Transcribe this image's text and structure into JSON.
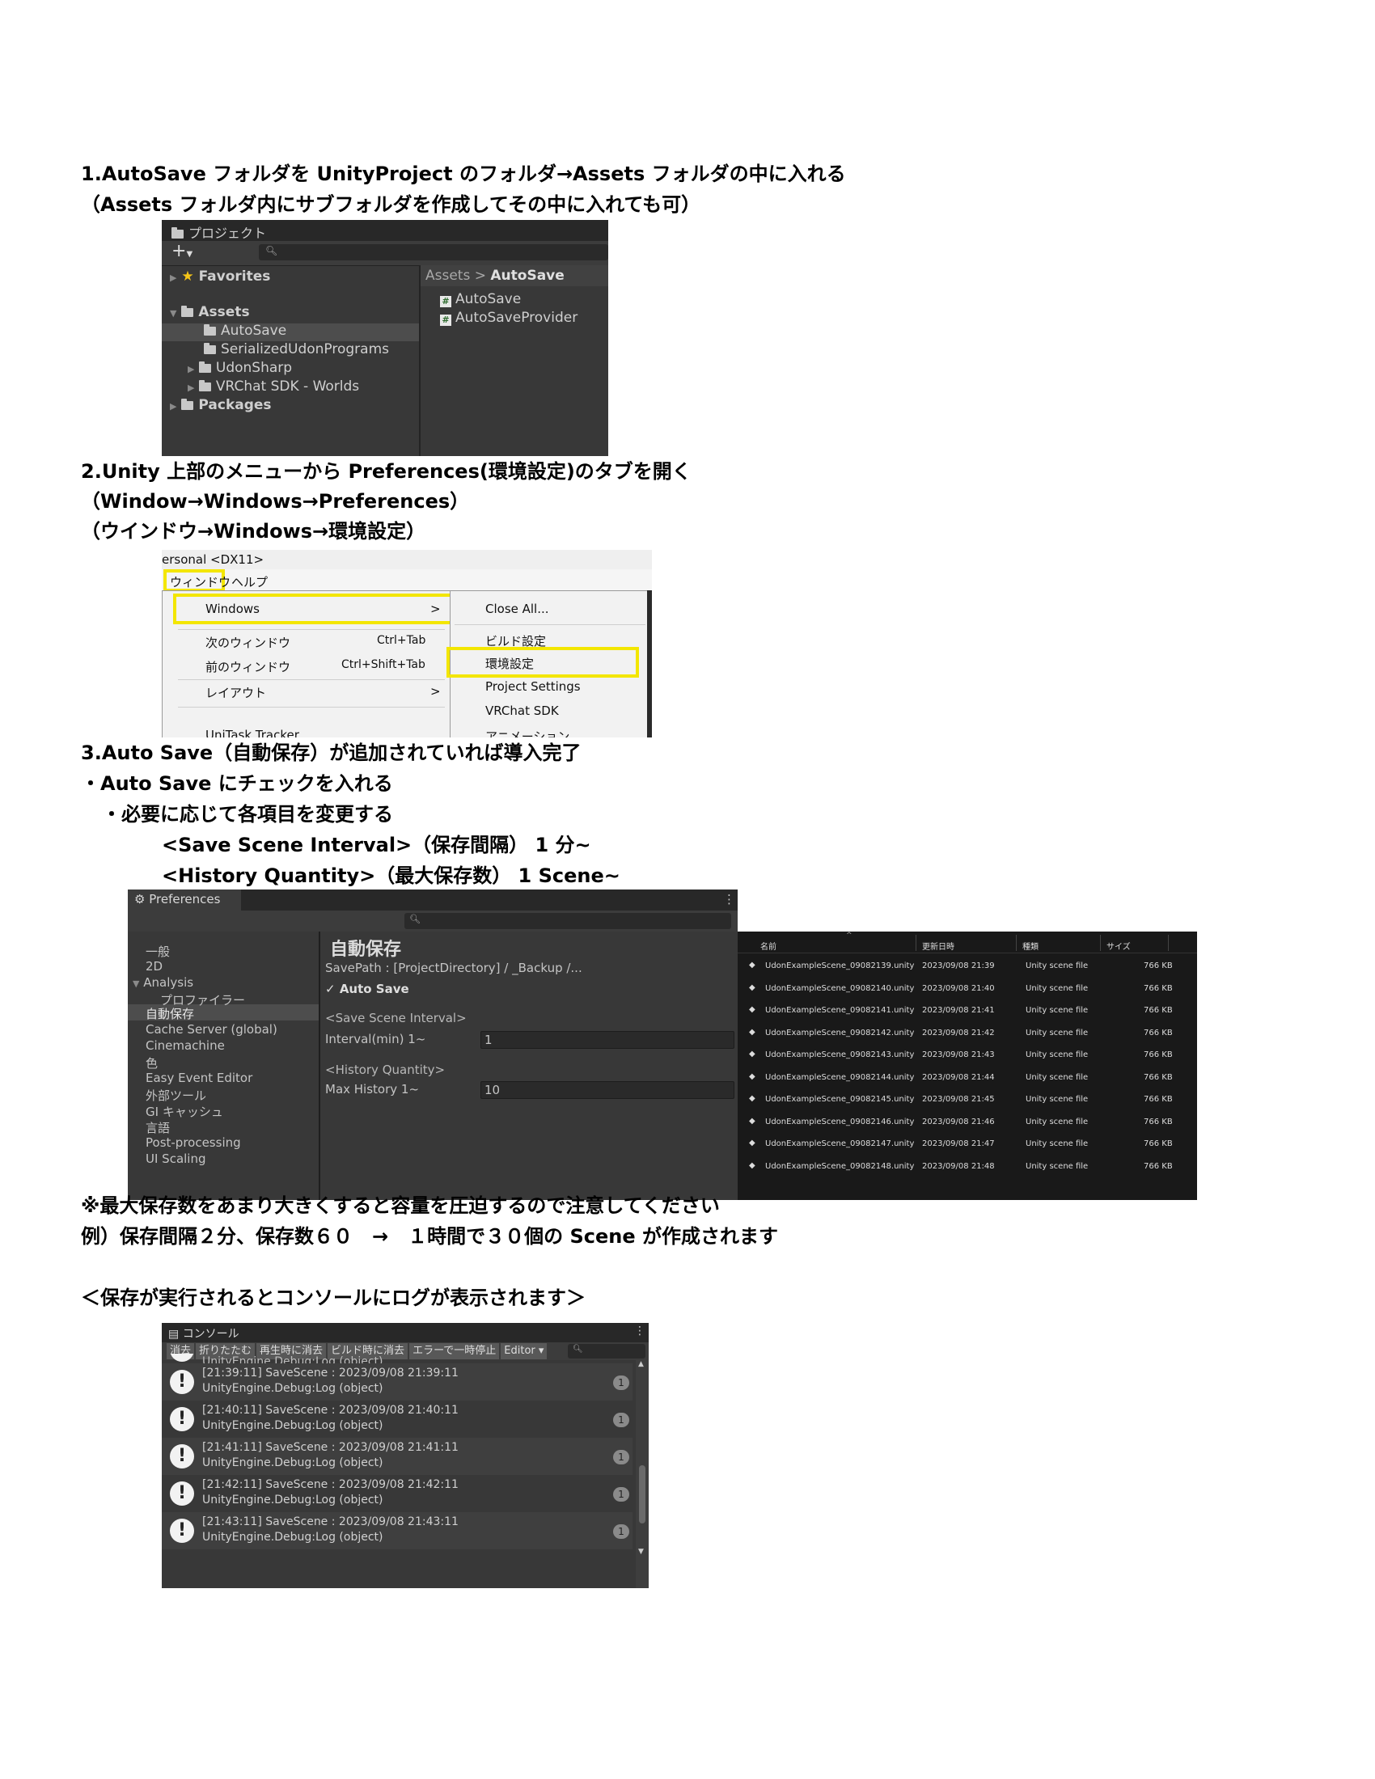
{
  "step1": {
    "line1": "1.AutoSave フォルダを UnityProject のフォルダ→Assets フォルダの中に入れる",
    "line2": "（Assets フォルダ内にサブフォルダを作成してその中に入れても可）"
  },
  "project_panel": {
    "tab_label": "プロジェクト",
    "add_label": "+",
    "favorites": "Favorites",
    "assets": "Assets",
    "folders": [
      "AutoSave",
      "SerializedUdonPrograms",
      "UdonSharp",
      "VRChat SDK - Worlds"
    ],
    "packages": "Packages",
    "breadcrumb_root": "Assets",
    "breadcrumb_sep": ">",
    "breadcrumb_current": "AutoSave",
    "files": [
      "AutoSave",
      "AutoSaveProvider"
    ]
  },
  "step2": {
    "line1": "2.Unity 上部のメニューから Preferences(環境設定)のタブを開く",
    "line2": "（Window→Windows→Preferences）",
    "line3": "（ウインドウ→Windows→環境設定）"
  },
  "menu": {
    "title_fragment": "ersonal <DX11>",
    "menubar": [
      "ウィンドウ",
      "ヘルプ"
    ],
    "left_items": [
      {
        "label": "Windows",
        "shortcut": ">"
      },
      {
        "label": "次のウィンドウ",
        "shortcut": "Ctrl+Tab"
      },
      {
        "label": "前のウィンドウ",
        "shortcut": "Ctrl+Shift+Tab"
      },
      {
        "label": "レイアウト",
        "shortcut": ">"
      },
      {
        "label": "UniTask Tracker",
        "shortcut": ""
      }
    ],
    "right_items": [
      "Close All...",
      "ビルド設定",
      "環境設定",
      "Project Settings",
      "VRChat SDK",
      "アニメーション"
    ]
  },
  "step3": {
    "line1": "3.Auto Save（自動保存）が追加されていれば導入完了",
    "line2": "・Auto Save にチェックを入れる",
    "line3": "・必要に応じて各項目を変更する",
    "line4": "<Save Scene Interval>（保存間隔） 1 分~",
    "line5": "<History Quantity>（最大保存数） 1 Scene~"
  },
  "preferences": {
    "tab_label": "Preferences",
    "menu_icon": "⋮",
    "categories": [
      "一般",
      "2D",
      "Analysis",
      "プロファイラー",
      "自動保存",
      "Cache Server (global)",
      "Cinemachine",
      "色",
      "Easy Event Editor",
      "外部ツール",
      "GI キャッシュ",
      "言語",
      "Post-processing",
      "UI Scaling"
    ],
    "section_title": "自動保存",
    "save_path": "SavePath : [ProjectDirectory] / _Backup /...",
    "auto_save_label": "Auto Save",
    "auto_save_checked": true,
    "interval_header": "<Save Scene Interval>",
    "interval_label": "Interval(min) 1~",
    "interval_value": "1",
    "history_header": "<History Quantity>",
    "history_label": "Max History 1~",
    "history_value": "10"
  },
  "explorer": {
    "columns": [
      "名前",
      "更新日時",
      "種類",
      "サイズ"
    ],
    "rows": [
      {
        "name": "UdonExampleScene_09082139.unity",
        "date": "2023/09/08 21:39",
        "type": "Unity scene file",
        "size": "766 KB"
      },
      {
        "name": "UdonExampleScene_09082140.unity",
        "date": "2023/09/08 21:40",
        "type": "Unity scene file",
        "size": "766 KB"
      },
      {
        "name": "UdonExampleScene_09082141.unity",
        "date": "2023/09/08 21:41",
        "type": "Unity scene file",
        "size": "766 KB"
      },
      {
        "name": "UdonExampleScene_09082142.unity",
        "date": "2023/09/08 21:42",
        "type": "Unity scene file",
        "size": "766 KB"
      },
      {
        "name": "UdonExampleScene_09082143.unity",
        "date": "2023/09/08 21:43",
        "type": "Unity scene file",
        "size": "766 KB"
      },
      {
        "name": "UdonExampleScene_09082144.unity",
        "date": "2023/09/08 21:44",
        "type": "Unity scene file",
        "size": "766 KB"
      },
      {
        "name": "UdonExampleScene_09082145.unity",
        "date": "2023/09/08 21:45",
        "type": "Unity scene file",
        "size": "766 KB"
      },
      {
        "name": "UdonExampleScene_09082146.unity",
        "date": "2023/09/08 21:46",
        "type": "Unity scene file",
        "size": "766 KB"
      },
      {
        "name": "UdonExampleScene_09082147.unity",
        "date": "2023/09/08 21:47",
        "type": "Unity scene file",
        "size": "766 KB"
      },
      {
        "name": "UdonExampleScene_09082148.unity",
        "date": "2023/09/08 21:48",
        "type": "Unity scene file",
        "size": "766 KB"
      }
    ]
  },
  "notes": {
    "warning": "※最大保存数をあまり大きくすると容量を圧迫するので注意してください",
    "example": "例）保存間隔２分、保存数６０　→　１時間で３０個の Scene が作成されます",
    "console_heading": "＜保存が実行されるとコンソールにログが表示されます＞"
  },
  "console": {
    "tab_label": "コンソール",
    "menu_icon": "⋮",
    "toolbar": [
      "消去",
      "折りたたむ",
      "再生時に消去",
      "ビルド時に消去",
      "エラーで一時停止",
      "Editor ▾"
    ],
    "partial_top": "UnityEngine.Debug:Log (object)",
    "logs": [
      {
        "line1": "[21:39:11] SaveScene : 2023/09/08 21:39:11",
        "line2": "UnityEngine.Debug:Log (object)",
        "count": "1"
      },
      {
        "line1": "[21:40:11] SaveScene : 2023/09/08 21:40:11",
        "line2": "UnityEngine.Debug:Log (object)",
        "count": "1"
      },
      {
        "line1": "[21:41:11] SaveScene : 2023/09/08 21:41:11",
        "line2": "UnityEngine.Debug:Log (object)",
        "count": "1"
      },
      {
        "line1": "[21:42:11] SaveScene : 2023/09/08 21:42:11",
        "line2": "UnityEngine.Debug:Log (object)",
        "count": "1"
      },
      {
        "line1": "[21:43:11] SaveScene : 2023/09/08 21:43:11",
        "line2": "UnityEngine.Debug:Log (object)",
        "count": "1"
      }
    ]
  },
  "colors": {
    "highlight": "#f3e600",
    "unity_panel": "#383838",
    "explorer_bg": "#191919"
  }
}
